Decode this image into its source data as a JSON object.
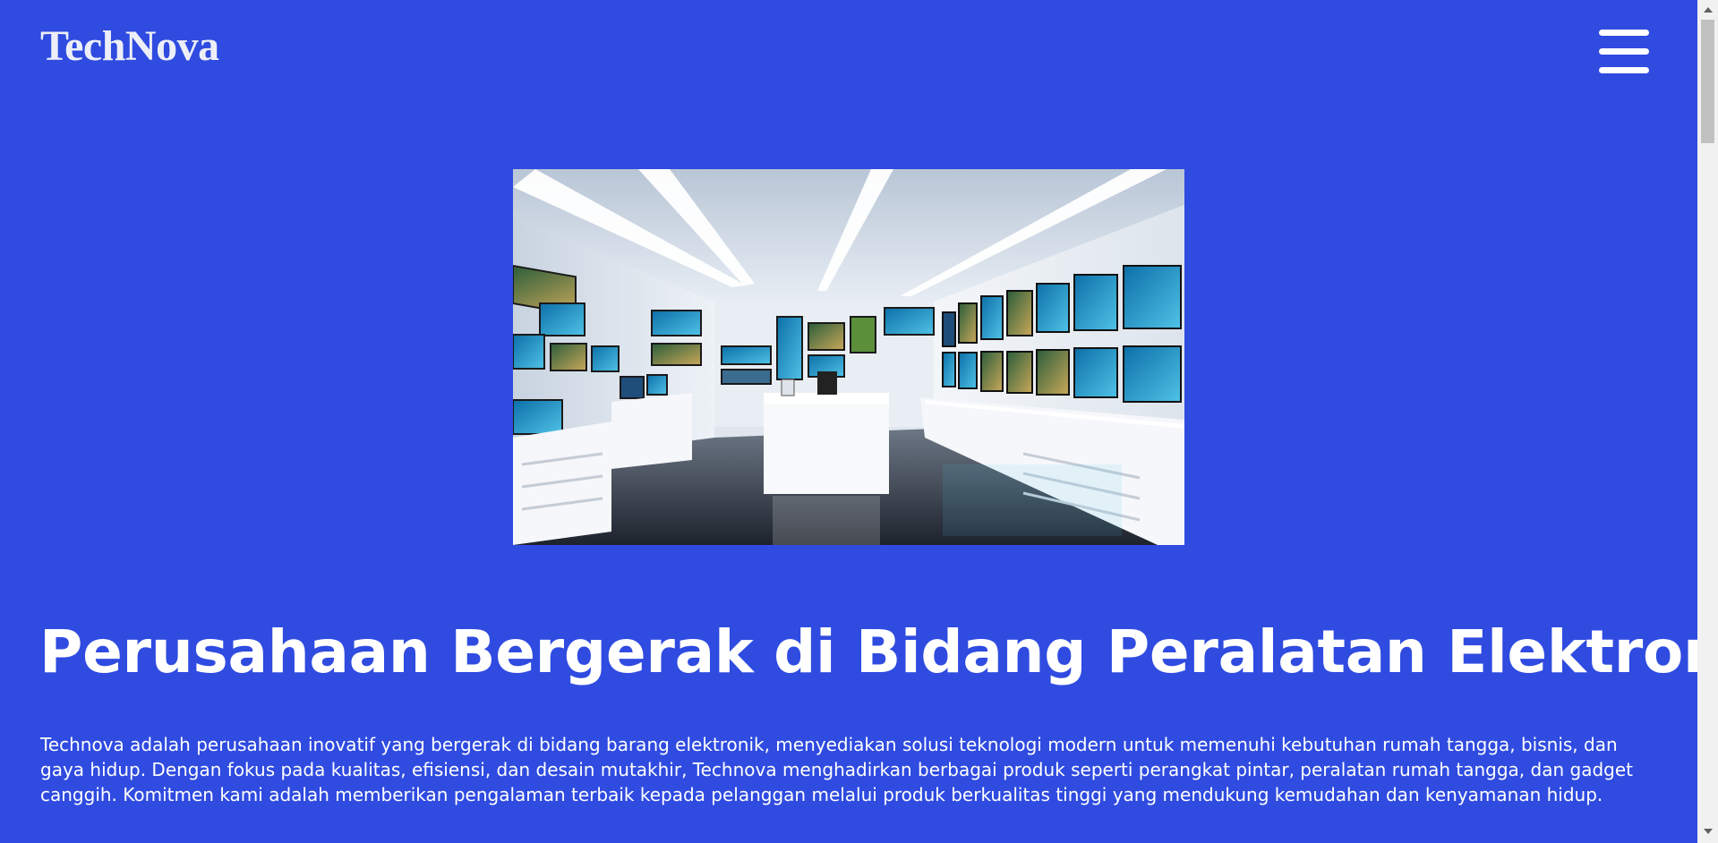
{
  "header": {
    "brand": "TechNova",
    "menu_icon": "hamburger-menu-icon"
  },
  "hero": {
    "image_icon": "store-photo"
  },
  "main": {
    "heading": "Perusahaan Bergerak di Bidang Peralatan Elektronik",
    "description": "Technova adalah perusahaan inovatif yang bergerak di bidang barang elektronik, menyediakan solusi teknologi modern untuk memenuhi kebutuhan rumah tangga, bisnis, dan gaya hidup. Dengan fokus pada kualitas, efisiensi, dan desain mutakhir, Technova menghadirkan berbagai produk seperti perangkat pintar, peralatan rumah tangga, dan gadget canggih. Komitmen kami adalah memberikan pengalaman terbaik kepada pelanggan melalui produk berkualitas tinggi yang mendukung kemudahan dan kenyamanan hidup."
  },
  "colors": {
    "background": "#2f4be0",
    "text": "#ffffff",
    "brand_text": "#eceff7"
  }
}
